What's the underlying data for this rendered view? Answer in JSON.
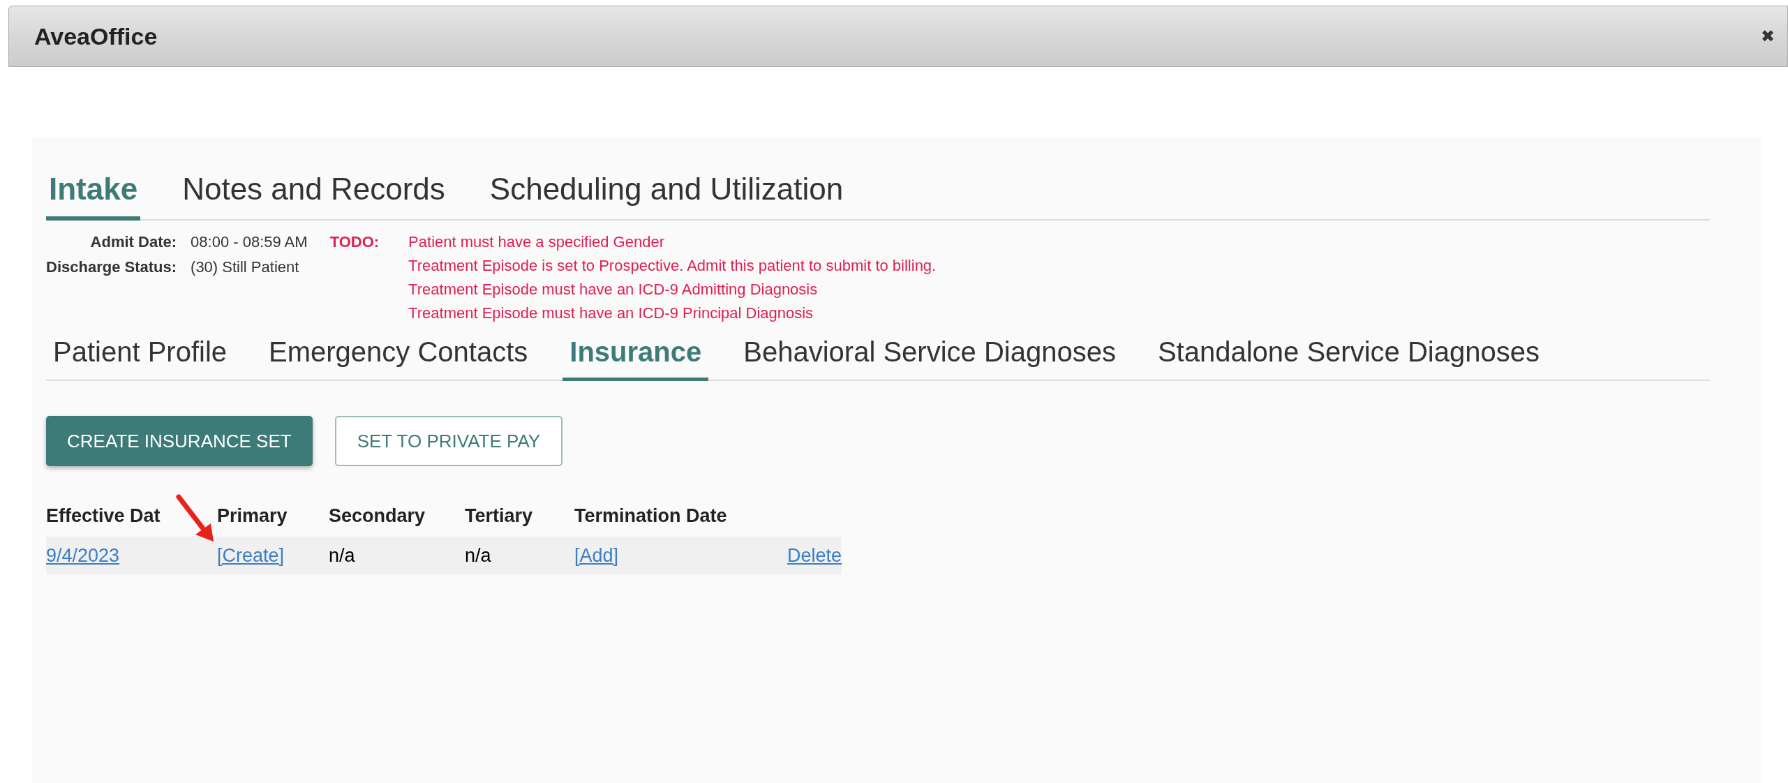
{
  "window": {
    "title": "AveaOffice",
    "close": "✖"
  },
  "main_tabs": [
    {
      "label": "Intake",
      "selected": true
    },
    {
      "label": "Notes and Records",
      "selected": false
    },
    {
      "label": "Scheduling and Utilization",
      "selected": false
    }
  ],
  "episode": {
    "fields": [
      {
        "label": "Admit Date:",
        "value": "08:00 - 08:59 AM"
      },
      {
        "label": "Discharge Status:",
        "value": "(30) Still Patient"
      }
    ],
    "todo": {
      "label": "TODO:",
      "messages": [
        "Patient must have a specified Gender",
        "Treatment Episode is set to Prospective. Admit this patient to submit to billing.",
        "Treatment Episode must have an ICD-9 Admitting Diagnosis",
        "Treatment Episode must have an ICD-9 Principal Diagnosis"
      ]
    }
  },
  "section_tabs": [
    {
      "label": "Patient Profile",
      "selected": false
    },
    {
      "label": "Emergency Contacts",
      "selected": false
    },
    {
      "label": "Insurance",
      "selected": true
    },
    {
      "label": "Behavioral Service Diagnoses",
      "selected": false
    },
    {
      "label": "Standalone Service Diagnoses",
      "selected": false
    }
  ],
  "buttons": [
    {
      "label": "CREATE INSURANCE SET",
      "kind": "primary"
    },
    {
      "label": "SET TO PRIVATE PAY",
      "kind": "outline"
    }
  ],
  "table": {
    "columns": [
      "Effective Dat",
      "Primary",
      "Secondary",
      "Tertiary",
      "Termination Date"
    ],
    "rows": [
      {
        "cells": [
          {
            "text": "9/4/2023",
            "kind": "link"
          },
          {
            "text": "[Create]",
            "kind": "link"
          },
          {
            "text": "n/a",
            "kind": "text"
          },
          {
            "text": "n/a",
            "kind": "text"
          },
          {
            "text": "[Add]",
            "kind": "link"
          },
          {
            "text": "Delete",
            "kind": "link"
          }
        ]
      }
    ]
  }
}
